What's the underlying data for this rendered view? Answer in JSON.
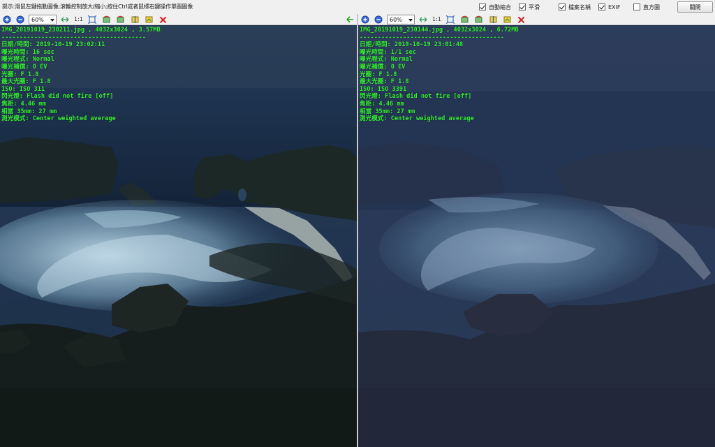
{
  "topbar": {
    "hint": "提示:滑鼠左鍵拖動圖像;滾輪控制放大/縮小;按住Ctrl或者鼠標右鍵操作單圖圖像",
    "options": [
      {
        "label": "自動縮合",
        "checked": true
      },
      {
        "label": "平滑",
        "checked": true
      },
      {
        "label": "檔案名稱",
        "checked": true
      },
      {
        "label": "EXIF",
        "checked": true
      },
      {
        "label": "直方圖",
        "checked": false
      }
    ],
    "close_label": "關閉"
  },
  "colors": {
    "exif_text": "#33ee33",
    "close_icon": "#e02020",
    "zoom_in_icon": "#2a5fd0",
    "next_arrow": "#22aa22"
  },
  "left": {
    "zoom": "60%",
    "one_to_one": "1:1",
    "filename_line": "IMG_20191019_230211.jpg , 4032x3024 , 3.57MB",
    "separator": "----------------------------------------",
    "exif": [
      "日期/時間: 2019-10-19 23:02:11",
      "曝光時間: 16 sec",
      "曝光程式: Normal",
      "曝光補償: 0 EV",
      "光圈: F 1.8",
      "最大光圈: F 1.8",
      "ISO: ISO 311",
      "閃光燈: Flash did not fire [off]",
      "焦距: 4.46 mm",
      "相當 35mm: 27 mm",
      "測光模式: Center weighted average"
    ]
  },
  "right": {
    "zoom": "60%",
    "one_to_one": "1:1",
    "filename_line": "IMG_20191019_230144.jpg , 4032x3024 , 6.72MB",
    "separator": "----------------------------------------",
    "exif": [
      "日期/時間: 2019-10-19 23:01:48",
      "曝光時間: 1/1 sec",
      "曝光程式: Normal",
      "曝光補償: 0 EV",
      "光圈: F 1.8",
      "最大光圈: F 1.8",
      "ISO: ISO 3391",
      "閃光燈: Flash did not fire [off]",
      "焦距: 4.46 mm",
      "相當 35mm: 27 mm",
      "測光模式: Center weighted average"
    ]
  }
}
